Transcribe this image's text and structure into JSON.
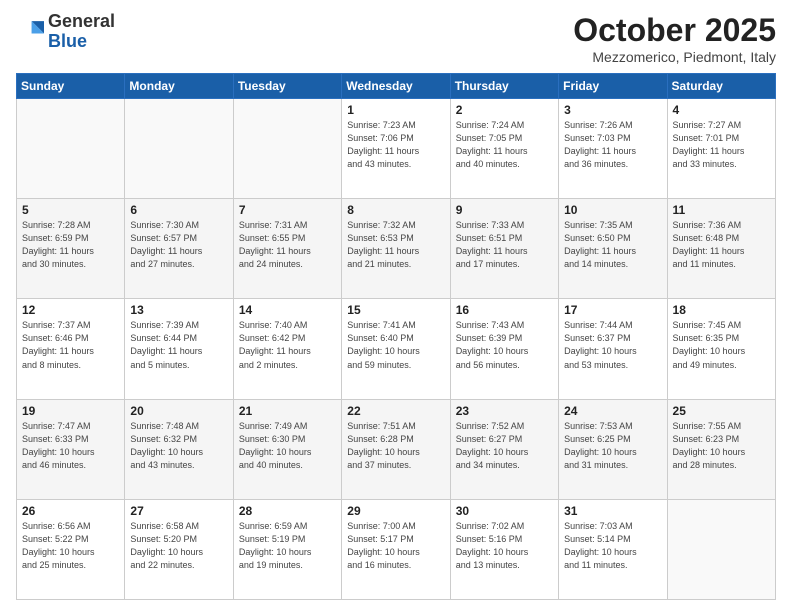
{
  "header": {
    "logo_general": "General",
    "logo_blue": "Blue",
    "title": "October 2025",
    "subtitle": "Mezzomerico, Piedmont, Italy"
  },
  "days_of_week": [
    "Sunday",
    "Monday",
    "Tuesday",
    "Wednesday",
    "Thursday",
    "Friday",
    "Saturday"
  ],
  "weeks": [
    [
      {
        "day": "",
        "info": ""
      },
      {
        "day": "",
        "info": ""
      },
      {
        "day": "",
        "info": ""
      },
      {
        "day": "1",
        "info": "Sunrise: 7:23 AM\nSunset: 7:06 PM\nDaylight: 11 hours\nand 43 minutes."
      },
      {
        "day": "2",
        "info": "Sunrise: 7:24 AM\nSunset: 7:05 PM\nDaylight: 11 hours\nand 40 minutes."
      },
      {
        "day": "3",
        "info": "Sunrise: 7:26 AM\nSunset: 7:03 PM\nDaylight: 11 hours\nand 36 minutes."
      },
      {
        "day": "4",
        "info": "Sunrise: 7:27 AM\nSunset: 7:01 PM\nDaylight: 11 hours\nand 33 minutes."
      }
    ],
    [
      {
        "day": "5",
        "info": "Sunrise: 7:28 AM\nSunset: 6:59 PM\nDaylight: 11 hours\nand 30 minutes."
      },
      {
        "day": "6",
        "info": "Sunrise: 7:30 AM\nSunset: 6:57 PM\nDaylight: 11 hours\nand 27 minutes."
      },
      {
        "day": "7",
        "info": "Sunrise: 7:31 AM\nSunset: 6:55 PM\nDaylight: 11 hours\nand 24 minutes."
      },
      {
        "day": "8",
        "info": "Sunrise: 7:32 AM\nSunset: 6:53 PM\nDaylight: 11 hours\nand 21 minutes."
      },
      {
        "day": "9",
        "info": "Sunrise: 7:33 AM\nSunset: 6:51 PM\nDaylight: 11 hours\nand 17 minutes."
      },
      {
        "day": "10",
        "info": "Sunrise: 7:35 AM\nSunset: 6:50 PM\nDaylight: 11 hours\nand 14 minutes."
      },
      {
        "day": "11",
        "info": "Sunrise: 7:36 AM\nSunset: 6:48 PM\nDaylight: 11 hours\nand 11 minutes."
      }
    ],
    [
      {
        "day": "12",
        "info": "Sunrise: 7:37 AM\nSunset: 6:46 PM\nDaylight: 11 hours\nand 8 minutes."
      },
      {
        "day": "13",
        "info": "Sunrise: 7:39 AM\nSunset: 6:44 PM\nDaylight: 11 hours\nand 5 minutes."
      },
      {
        "day": "14",
        "info": "Sunrise: 7:40 AM\nSunset: 6:42 PM\nDaylight: 11 hours\nand 2 minutes."
      },
      {
        "day": "15",
        "info": "Sunrise: 7:41 AM\nSunset: 6:40 PM\nDaylight: 10 hours\nand 59 minutes."
      },
      {
        "day": "16",
        "info": "Sunrise: 7:43 AM\nSunset: 6:39 PM\nDaylight: 10 hours\nand 56 minutes."
      },
      {
        "day": "17",
        "info": "Sunrise: 7:44 AM\nSunset: 6:37 PM\nDaylight: 10 hours\nand 53 minutes."
      },
      {
        "day": "18",
        "info": "Sunrise: 7:45 AM\nSunset: 6:35 PM\nDaylight: 10 hours\nand 49 minutes."
      }
    ],
    [
      {
        "day": "19",
        "info": "Sunrise: 7:47 AM\nSunset: 6:33 PM\nDaylight: 10 hours\nand 46 minutes."
      },
      {
        "day": "20",
        "info": "Sunrise: 7:48 AM\nSunset: 6:32 PM\nDaylight: 10 hours\nand 43 minutes."
      },
      {
        "day": "21",
        "info": "Sunrise: 7:49 AM\nSunset: 6:30 PM\nDaylight: 10 hours\nand 40 minutes."
      },
      {
        "day": "22",
        "info": "Sunrise: 7:51 AM\nSunset: 6:28 PM\nDaylight: 10 hours\nand 37 minutes."
      },
      {
        "day": "23",
        "info": "Sunrise: 7:52 AM\nSunset: 6:27 PM\nDaylight: 10 hours\nand 34 minutes."
      },
      {
        "day": "24",
        "info": "Sunrise: 7:53 AM\nSunset: 6:25 PM\nDaylight: 10 hours\nand 31 minutes."
      },
      {
        "day": "25",
        "info": "Sunrise: 7:55 AM\nSunset: 6:23 PM\nDaylight: 10 hours\nand 28 minutes."
      }
    ],
    [
      {
        "day": "26",
        "info": "Sunrise: 6:56 AM\nSunset: 5:22 PM\nDaylight: 10 hours\nand 25 minutes."
      },
      {
        "day": "27",
        "info": "Sunrise: 6:58 AM\nSunset: 5:20 PM\nDaylight: 10 hours\nand 22 minutes."
      },
      {
        "day": "28",
        "info": "Sunrise: 6:59 AM\nSunset: 5:19 PM\nDaylight: 10 hours\nand 19 minutes."
      },
      {
        "day": "29",
        "info": "Sunrise: 7:00 AM\nSunset: 5:17 PM\nDaylight: 10 hours\nand 16 minutes."
      },
      {
        "day": "30",
        "info": "Sunrise: 7:02 AM\nSunset: 5:16 PM\nDaylight: 10 hours\nand 13 minutes."
      },
      {
        "day": "31",
        "info": "Sunrise: 7:03 AM\nSunset: 5:14 PM\nDaylight: 10 hours\nand 11 minutes."
      },
      {
        "day": "",
        "info": ""
      }
    ]
  ]
}
